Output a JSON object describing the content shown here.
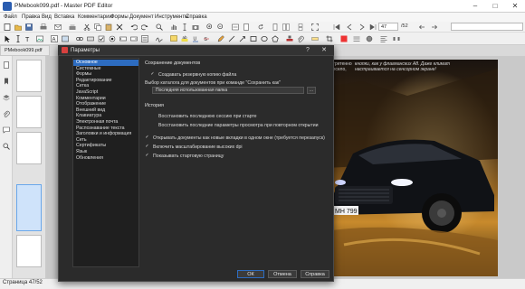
{
  "window": {
    "title": "PMebook099.pdf - Master PDF Editor"
  },
  "menu": [
    "Файл",
    "Правка",
    "Вид",
    "Вставка",
    "Комментарии",
    "Формы",
    "Документ",
    "Инструменты",
    "Справка"
  ],
  "toolbar": {
    "page_current": "47",
    "page_total": "/52"
  },
  "left_panel": {
    "doc_tab": "PMebook099.pdf"
  },
  "document": {
    "caption_left": "отретенно весело,",
    "caption_right": "кнопки, как у флагманских А8. Даже климат настраивается на сенсорном экране!",
    "plate": "МН 799"
  },
  "statusbar": {
    "text": "Страница 47/52"
  },
  "dialog": {
    "title": "Параметры",
    "help": "?",
    "close": "✕",
    "categories": [
      "Основное",
      "Системные",
      "Формы",
      "Редактирование",
      "Сетка",
      "JavaScript",
      "Комментарии",
      "Отображение",
      "Внешний вид",
      "Клавиатура",
      "Электронная почта",
      "Распознавание текста",
      "Заголовки и информация",
      "Сеть",
      "Сертификаты",
      "Язык",
      "Обновления"
    ],
    "selected_category": 0,
    "section_save": "Сохранение документов",
    "opt_backup": "Создавать резервную копию файла",
    "folder_label": "Выбор каталога для документов при команде \"Сохранить как\"",
    "folder_value": "Последняя использованная папка",
    "folder_btn": "...",
    "section_history": "История",
    "opt_restore_session": "Восстановить последнюю сессию при старте",
    "opt_restore_view": "Восстановить последние параметры просмотра при повторном открытии",
    "opt_new_tabs": "Открывать документы как новые вкладки в одном окне (требуется перезапуск)",
    "opt_scaling": "Включить масштабирование высоких dpi",
    "opt_startpage": "Показывать стартовую страницу",
    "btn_ok": "ОК",
    "btn_cancel": "Отмена",
    "btn_apply": "Справка",
    "checks": {
      "backup": true,
      "restore_session": false,
      "restore_view": false,
      "new_tabs": true,
      "scaling": true,
      "startpage": true
    }
  },
  "colors": {
    "accent": "#2d6cc0",
    "dialog_bg": "#2b2b2b",
    "app_icon": "#d8413f"
  }
}
